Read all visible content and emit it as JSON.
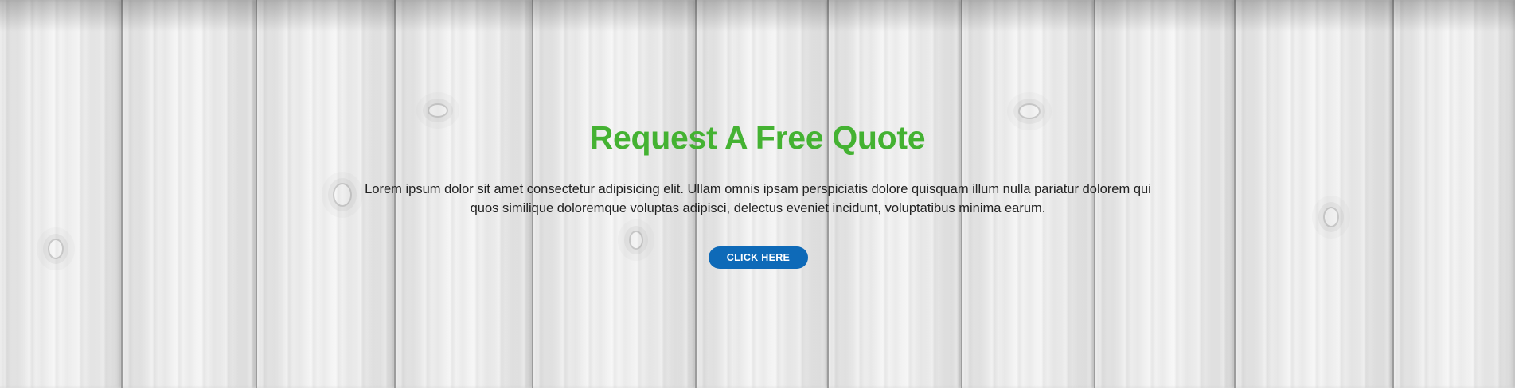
{
  "section": {
    "title": "Request A Free Quote",
    "description": "Lorem ipsum dolor sit amet consectetur adipisicing elit. Ullam omnis ipsam perspiciatis dolore quisquam illum nulla pariatur dolorem qui quos similique doloremque voluptas adipisci, delectus eveniet incidunt, voluptatibus minima earum.",
    "button_label": "CLICK HERE"
  },
  "colors": {
    "title": "#44b232",
    "button": "#0e6ab8",
    "text": "#222222"
  },
  "background": {
    "texture": "white-wood-planks"
  }
}
